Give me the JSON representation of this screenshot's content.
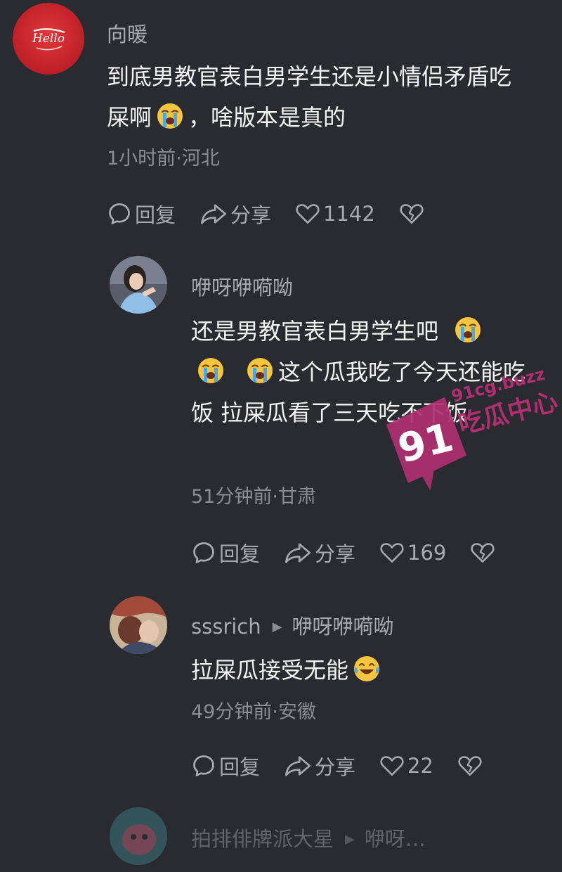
{
  "comments": [
    {
      "username": "向暖",
      "text_parts": [
        "到底男教官表白男学生还是小情侣矛盾吃屎啊",
        "，啥版本是真的"
      ],
      "meta": "1小时前·河北",
      "reply_label": "回复",
      "share_label": "分享",
      "like_count": "1142",
      "avatar_lettering": "Hello"
    },
    {
      "username": "咿呀咿嗬呦",
      "text_parts": [
        "还是男教官表白男学生吧",
        "这个瓜我吃了今天还能吃饭 拉屎瓜看了三天吃不下饭"
      ],
      "meta": "51分钟前·甘肃",
      "reply_label": "回复",
      "share_label": "分享",
      "like_count": "169"
    },
    {
      "username": "sssrich",
      "reply_to": "咿呀咿嗬呦",
      "text_parts": [
        "拉屎瓜接受无能"
      ],
      "meta": "49分钟前·安徽",
      "reply_label": "回复",
      "share_label": "分享",
      "like_count": "22"
    },
    {
      "username": "拍排俳牌派大星",
      "reply_to": "咿呀…"
    }
  ],
  "watermark": {
    "number": "91",
    "site": "91cg.buzz",
    "label": "吃瓜中心",
    "color": "#b0306f"
  },
  "icons": {
    "reply": "comment-bubble-icon",
    "share": "share-arrow-icon",
    "like": "heart-icon",
    "dislike": "broken-heart-icon",
    "emoji_crying": "loudly-crying-face-icon",
    "emoji_laughing": "tears-of-joy-face-icon"
  }
}
